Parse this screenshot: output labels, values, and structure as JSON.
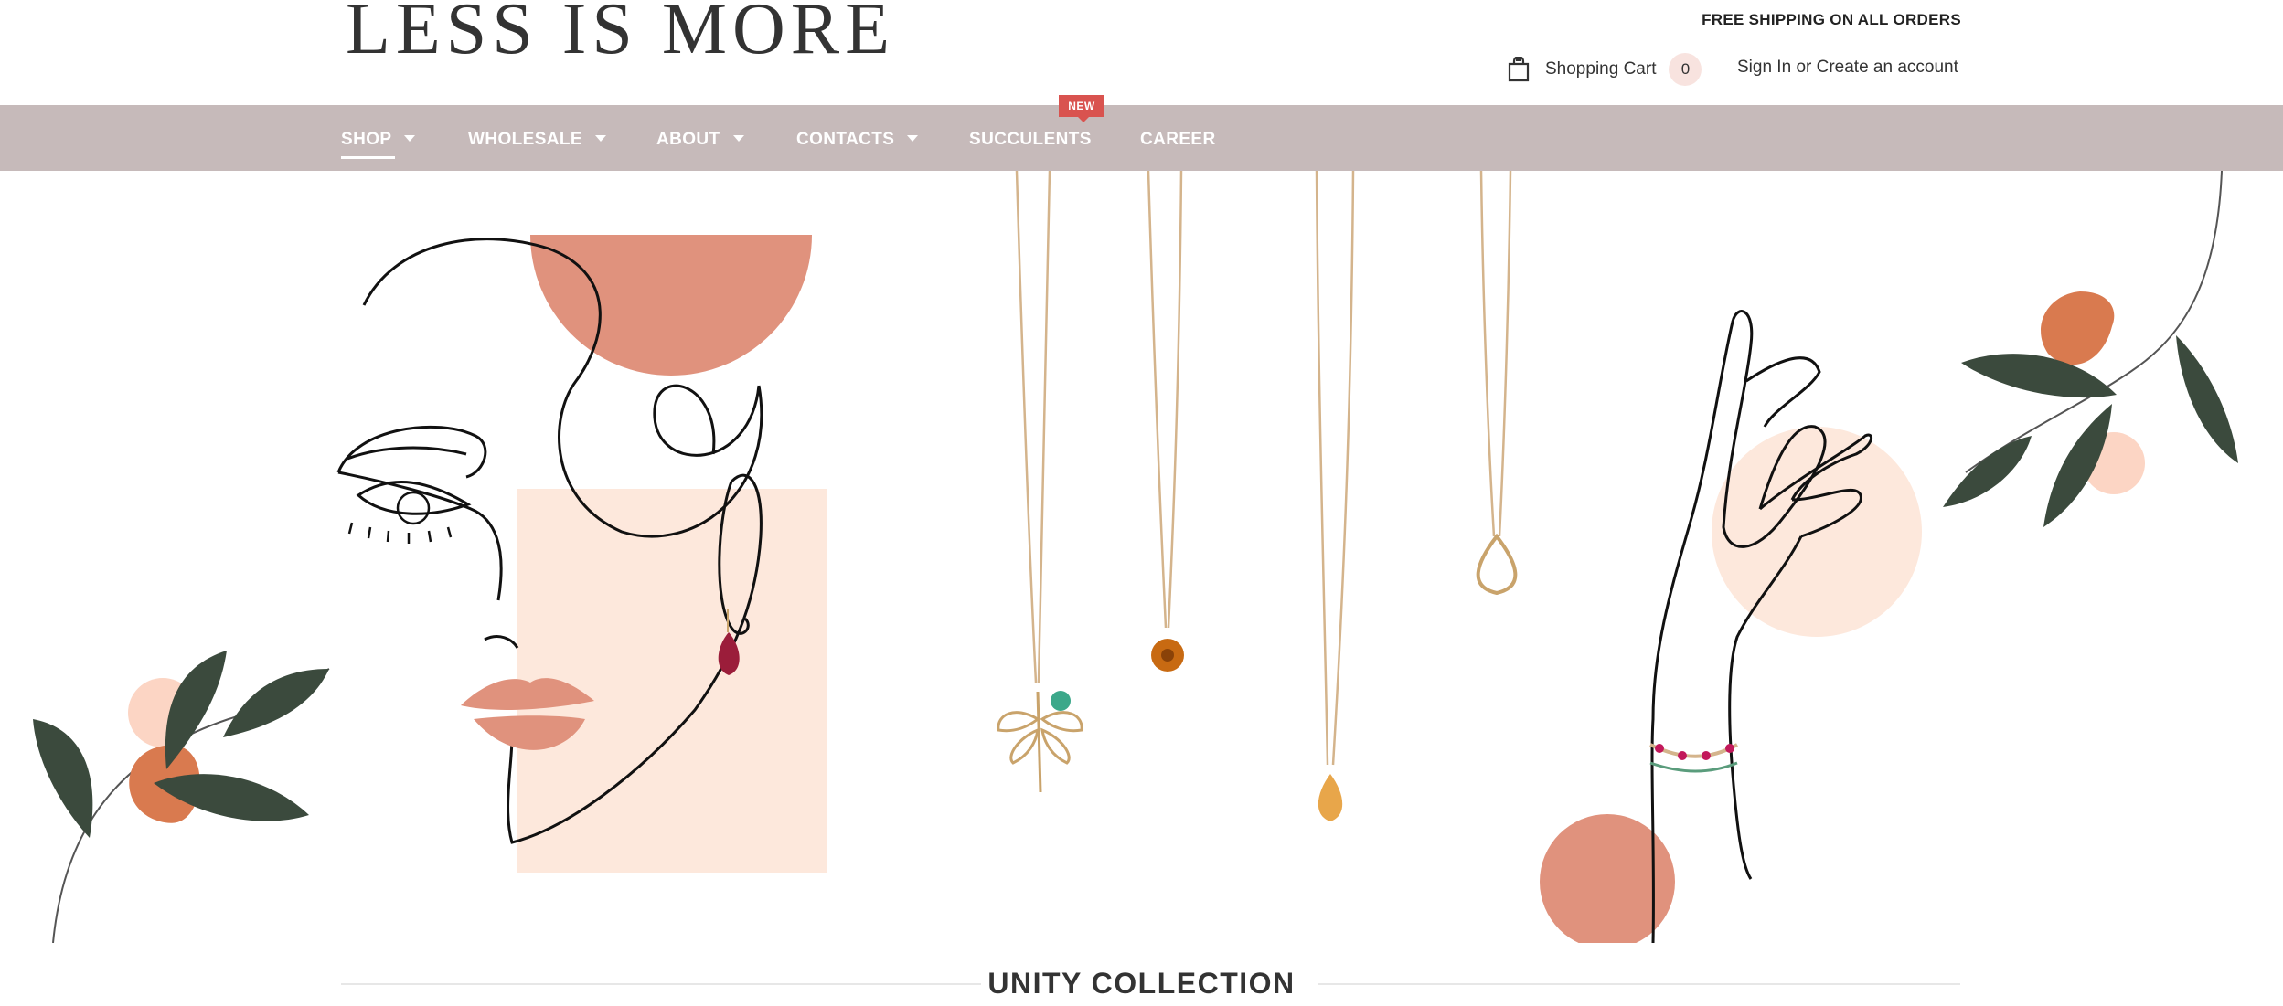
{
  "brand": {
    "logo_text": "LESS IS MORE"
  },
  "header": {
    "free_shipping": "FREE SHIPPING ON ALL ORDERS",
    "cart_label": "Shopping Cart",
    "cart_count": "0",
    "sign_in": "Sign In",
    "or_text": "or",
    "create_account": "Create an account"
  },
  "nav": {
    "items": [
      {
        "label": "SHOP",
        "has_dropdown": true,
        "active": true
      },
      {
        "label": "WHOLESALE",
        "has_dropdown": true
      },
      {
        "label": "ABOUT",
        "has_dropdown": true
      },
      {
        "label": "CONTACTS",
        "has_dropdown": true
      },
      {
        "label": "SUCCULENTS",
        "has_dropdown": false,
        "badge": "NEW"
      },
      {
        "label": "CAREER",
        "has_dropdown": false
      }
    ]
  },
  "hero": {
    "description": "Illustrated banner: line-art face, hanging necklaces, hand with bracelet, leaves and peach circles",
    "colors": {
      "terracotta": "#e0927d",
      "blush": "#fde8dc",
      "leaf": "#3b4a3d",
      "orange": "#d97a4f",
      "gold": "#d4b48c"
    }
  },
  "collection": {
    "title": "UNITY COLLECTION"
  },
  "colors": {
    "nav_bg": "#c6baba",
    "badge": "#d9534f",
    "cart_count_bg": "#f8e3df"
  }
}
